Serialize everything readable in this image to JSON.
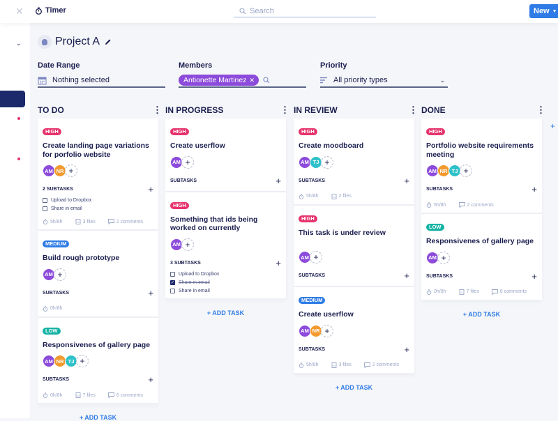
{
  "topbar": {
    "app_title": "Timer",
    "search_placeholder": "Search",
    "new_label": "New"
  },
  "project": {
    "title": "Project A"
  },
  "filters": {
    "date_range": {
      "label": "Date Range",
      "value": "Nothing selected"
    },
    "members": {
      "label": "Members",
      "chip": "Antionette Martinez"
    },
    "priority": {
      "label": "Priority",
      "value": "All priority types"
    }
  },
  "colors": {
    "high": "#e6336d",
    "medium": "#2f7ce6",
    "low": "#14b3a3",
    "AM": "#8c4bdb",
    "NR": "#f39a2e",
    "TJ": "#2fc1c9"
  },
  "add_task_label": "+ ADD TASK",
  "columns": [
    {
      "title": "TO DO",
      "cards": [
        {
          "priority": "HIGH",
          "title": "Create landing page variations for porfolio website",
          "members": [
            "AM",
            "NR"
          ],
          "subtasks_label": "2 SUBTASKS",
          "subtasks": [
            {
              "text": "Upload to Dropbox",
              "done": false
            },
            {
              "text": "Share in email",
              "done": false
            }
          ],
          "time": "5h/8h",
          "files": "3 files",
          "comments": "2 comments"
        },
        {
          "priority": "MEDIUM",
          "title": "Build rough prototype",
          "members": [
            "AM"
          ],
          "subtasks_label": "SUBTASKS",
          "subtasks": [],
          "time": "0h/8h"
        },
        {
          "priority": "LOW",
          "title": "Responsivenes of gallery page",
          "members": [
            "AM",
            "NR",
            "TJ"
          ],
          "subtasks_label": "SUBTASKS",
          "subtasks": [],
          "time": "0h/8h",
          "files": "7 files",
          "comments": "6 comments"
        }
      ]
    },
    {
      "title": "IN PROGRESS",
      "cards": [
        {
          "priority": "HIGH",
          "title": "Create userflow",
          "members": [
            "AM"
          ],
          "subtasks_label": "SUBTASKS",
          "subtasks": []
        },
        {
          "priority": "HIGH",
          "title": "Something that ids being worked on currently",
          "members": [
            "AM"
          ],
          "subtasks_label": "3 SUBTASKS",
          "subtasks": [
            {
              "text": "Upload to Dropbox",
              "done": false
            },
            {
              "text": "Share in email",
              "done": true
            },
            {
              "text": "Share in email",
              "done": false
            }
          ]
        }
      ]
    },
    {
      "title": "IN REVIEW",
      "cards": [
        {
          "priority": "HIGH",
          "title": "Create moodboard",
          "members": [
            "AM",
            "TJ"
          ],
          "subtasks_label": "SUBTASKS",
          "subtasks": [],
          "time": "5h/8h",
          "files": "2 files"
        },
        {
          "priority": "HIGH",
          "title": "This task is under review",
          "members": [
            "AM"
          ],
          "subtasks_label": "SUBTASKS",
          "subtasks": [],
          "spacer": true
        },
        {
          "priority": "MEDIUM",
          "title": "Create userflow",
          "members": [
            "AM",
            "NR"
          ],
          "subtasks_label": "SUBTASKS",
          "subtasks": [],
          "time": "5h/8h",
          "files": "3 files",
          "comments": "2 comments"
        }
      ]
    },
    {
      "title": "DONE",
      "cards": [
        {
          "priority": "HIGH",
          "title": "Portfolio website requirements meeting",
          "members": [
            "AM",
            "NR",
            "TJ"
          ],
          "subtasks_label": "SUBTASKS",
          "subtasks": [],
          "time": "5h/8h",
          "comments": "2 comments"
        },
        {
          "priority": "LOW",
          "title": "Responsivenes of gallery page",
          "members": [
            "AM"
          ],
          "subtasks_label": "SUBTASKS",
          "subtasks": [],
          "time": "0h/8h",
          "files": "7 files",
          "comments": "6 comments"
        }
      ]
    }
  ]
}
